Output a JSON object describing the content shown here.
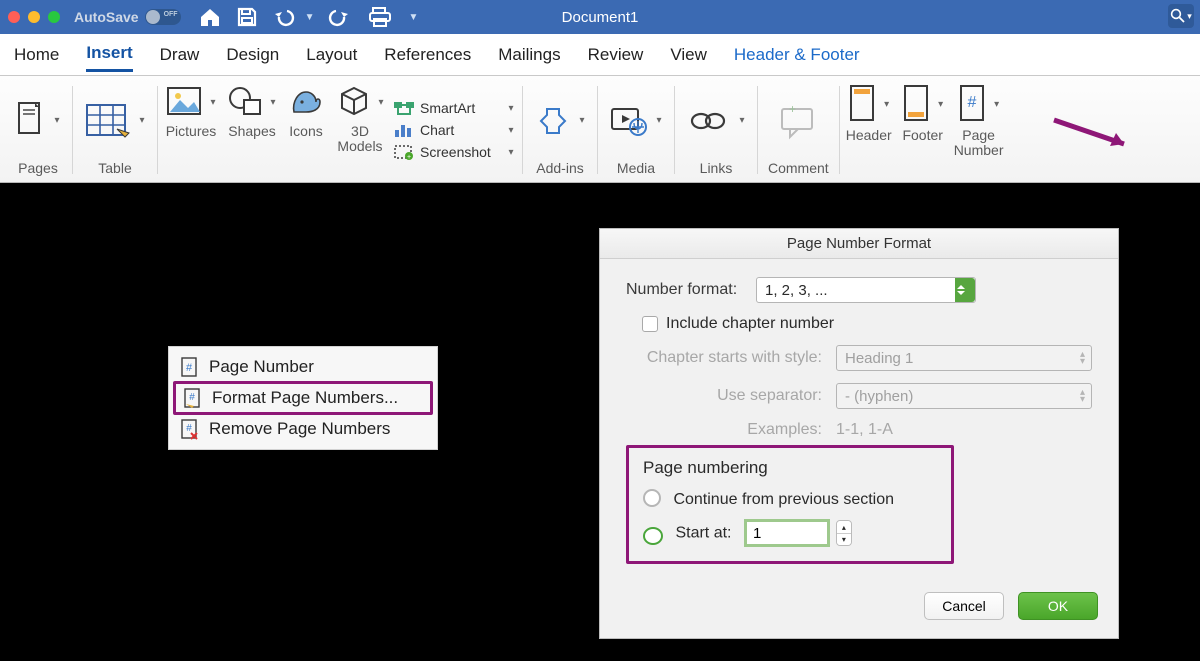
{
  "titlebar": {
    "autosave_label": "AutoSave",
    "switch_label": "OFF",
    "document_title": "Document1"
  },
  "tabs": {
    "home": "Home",
    "insert": "Insert",
    "draw": "Draw",
    "design": "Design",
    "layout": "Layout",
    "references": "References",
    "mailings": "Mailings",
    "review": "Review",
    "view": "View",
    "header_footer": "Header & Footer"
  },
  "ribbon": {
    "pages": "Pages",
    "table": "Table",
    "pictures": "Pictures",
    "shapes": "Shapes",
    "icons": "Icons",
    "models": "3D\nModels",
    "smartart": "SmartArt",
    "chart": "Chart",
    "screenshot": "Screenshot",
    "addins": "Add-ins",
    "media": "Media",
    "links": "Links",
    "comment": "Comment",
    "header": "Header",
    "footer": "Footer",
    "page_number": "Page\nNumber"
  },
  "context_menu": {
    "page_number": "Page Number",
    "format_page_numbers": "Format Page Numbers...",
    "remove_page_numbers": "Remove Page Numbers"
  },
  "dialog": {
    "title": "Page Number Format",
    "number_format_label": "Number format:",
    "number_format_value": "1, 2, 3, ...",
    "include_chapter_label": "Include chapter number",
    "chapter_style_label": "Chapter starts with style:",
    "chapter_style_value": "Heading 1",
    "separator_label": "Use separator:",
    "separator_value": "-     (hyphen)",
    "examples_label": "Examples:",
    "examples_value": "1-1, 1-A",
    "section_label": "Page numbering",
    "continue_label": "Continue from previous section",
    "start_at_label": "Start at:",
    "start_at_value": "1",
    "cancel": "Cancel",
    "ok": "OK"
  }
}
